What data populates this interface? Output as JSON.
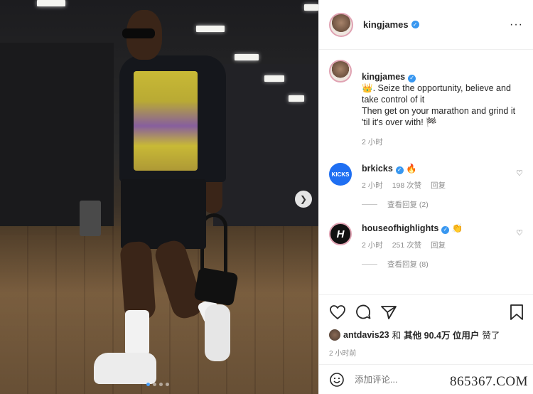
{
  "header": {
    "username": "kingjames",
    "more_label": "···"
  },
  "caption": {
    "username": "kingjames",
    "text": "👑. Seize the opportunity, believe and take control of it\nThen get on your marathon and grind it 'til it's over with! 🏁",
    "time": "2 小时"
  },
  "comments": [
    {
      "username": "brkicks",
      "avatar_text": "KICKS",
      "text": "🔥",
      "time": "2 小时",
      "likes": "198 次赞",
      "reply_label": "回复",
      "view_replies": "查看回复 (2)"
    },
    {
      "username": "houseofhighlights",
      "avatar_text": "H",
      "text": "👏",
      "time": "2 小时",
      "likes": "251 次赞",
      "reply_label": "回复",
      "view_replies": "查看回复 (8)"
    }
  ],
  "likes_line": {
    "user": "antdavis23",
    "and": "和",
    "others": "其他 90.4万 位用户",
    "suffix": "赞了"
  },
  "posted_ago": "2 小时前",
  "comment_input": {
    "placeholder": "添加评论..."
  },
  "watermark": "865367.COM",
  "carousel": {
    "total": 4,
    "active": 1
  },
  "colors": {
    "accent": "#3897f0",
    "kicks_bg": "#1f6ff2"
  },
  "icons": [
    "heart-icon",
    "comment-icon",
    "share-icon",
    "bookmark-icon",
    "emoji-icon",
    "chevron-right-icon",
    "more-icon",
    "verified-icon"
  ]
}
